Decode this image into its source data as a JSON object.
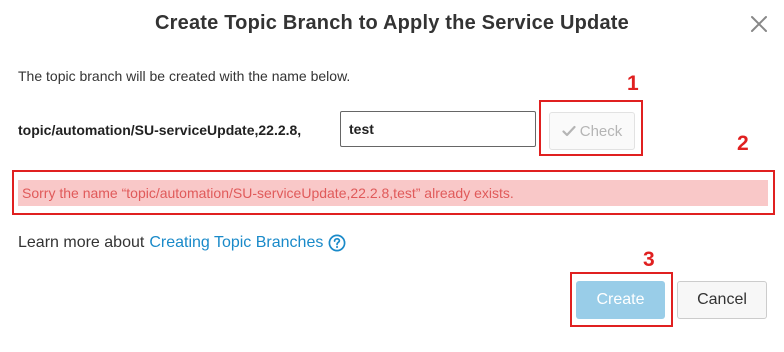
{
  "dialog": {
    "title": "Create Topic Branch to Apply the Service Update",
    "intro": "The topic branch will be created with the name below.",
    "branch_prefix": "topic/automation/SU-serviceUpdate,22.2.8,",
    "name_value": "test",
    "check_label": "Check",
    "error_message": "Sorry the name “topic/automation/SU-serviceUpdate,22.2.8,test” already exists.",
    "learn_more_text": "Learn more about",
    "learn_more_link": "Creating Topic Branches",
    "create_label": "Create",
    "cancel_label": "Cancel"
  },
  "annotations": {
    "label_1": "1",
    "label_2": "2",
    "label_3": "3"
  },
  "colors": {
    "annotation": "#e02020",
    "link": "#1a8ac9",
    "error_bg": "#f9c8c8",
    "error_text": "#e05a5a",
    "create_bg": "#99cde8"
  },
  "icons": {
    "close": "close-icon",
    "check": "checkmark-icon",
    "help": "question-circle-icon"
  }
}
